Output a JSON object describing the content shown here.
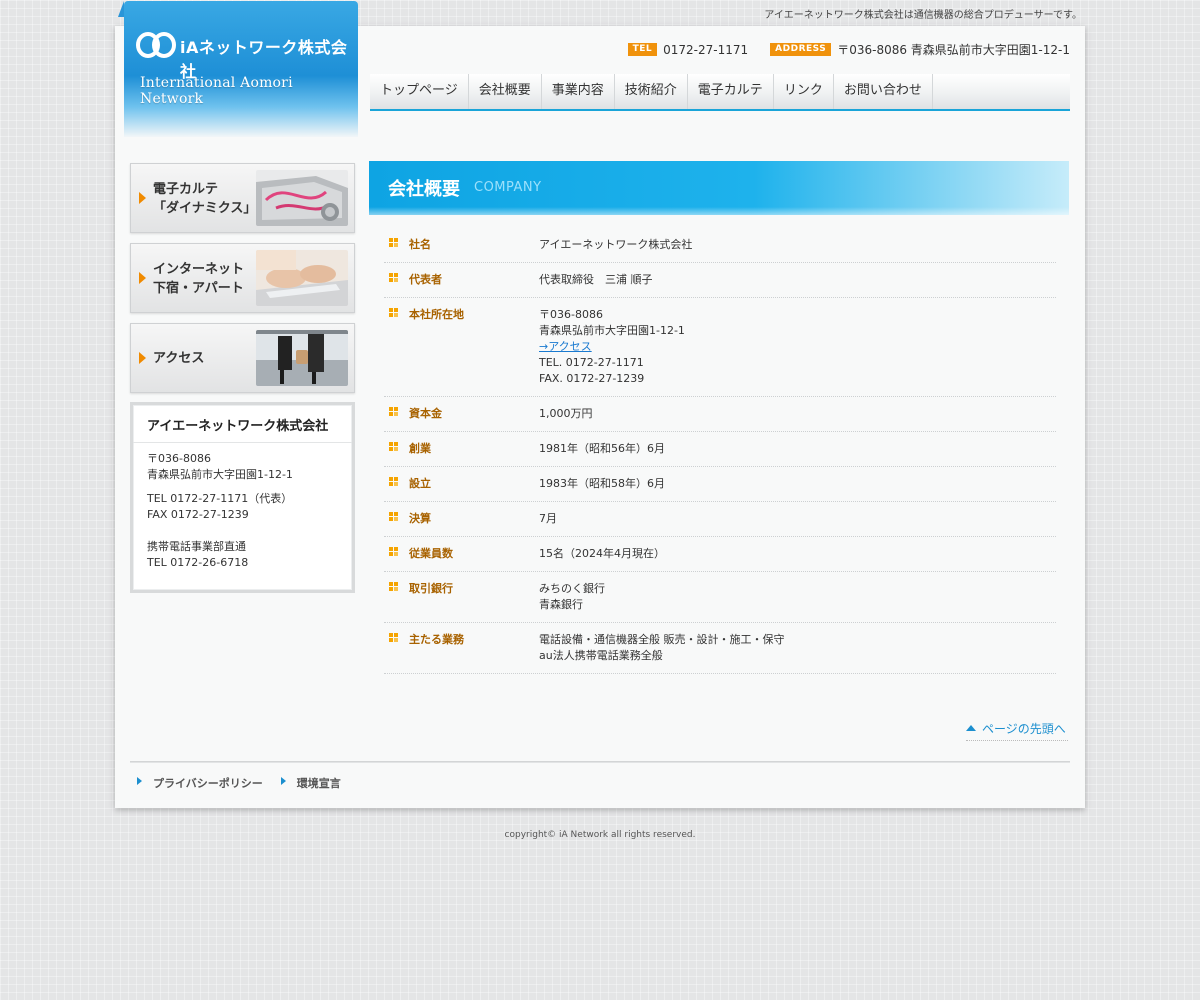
{
  "tagline": "アイエーネットワーク株式会社は通信機器の総合プロデューサーです。",
  "logo": {
    "text": "iAネットワーク株式会社",
    "sub": "International Aomori Network"
  },
  "contact": {
    "tel_badge": "TEL",
    "tel": "0172-27-1171",
    "address_badge": "ADDRESS",
    "address": "〒036-8086 青森県弘前市大字田園1-12-1"
  },
  "nav": [
    {
      "label": "トップページ"
    },
    {
      "label": "会社概要"
    },
    {
      "label": "事業内容"
    },
    {
      "label": "技術紹介"
    },
    {
      "label": "電子カルテ"
    },
    {
      "label": "リンク"
    },
    {
      "label": "お問い合わせ"
    }
  ],
  "sidebar": {
    "banners": [
      {
        "line1": "電子カルテ",
        "line2": "「ダイナミクス」"
      },
      {
        "line1": "インターネット",
        "line2": "下宿・アパート"
      },
      {
        "line1": "アクセス",
        "line2": ""
      }
    ],
    "company": {
      "name": "アイエーネットワーク株式会社",
      "zip": "〒036-8086",
      "addr": "青森県弘前市大字田園1-12-1",
      "tel": "TEL 0172-27-1171（代表）",
      "fax": "FAX 0172-27-1239",
      "mobile_label": "携帯電話事業部直通",
      "mobile_tel": "TEL 0172-26-6718"
    }
  },
  "heading": {
    "jp": "会社概要",
    "en": "COMPANY"
  },
  "rows": [
    {
      "label": "社名",
      "lines": [
        "アイエーネットワーク株式会社"
      ]
    },
    {
      "label": "代表者",
      "lines": [
        "代表取締役　三浦 順子"
      ]
    },
    {
      "label": "本社所在地",
      "lines": [
        "〒036-8086",
        "青森県弘前市大字田園1-12-1"
      ],
      "link": "→アクセス",
      "after": [
        "TEL. 0172-27-1171",
        "FAX. 0172-27-1239"
      ]
    },
    {
      "label": "資本金",
      "lines": [
        "1,000万円"
      ]
    },
    {
      "label": "創業",
      "lines": [
        "1981年（昭和56年）6月"
      ]
    },
    {
      "label": "設立",
      "lines": [
        "1983年（昭和58年）6月"
      ]
    },
    {
      "label": "決算",
      "lines": [
        "7月"
      ]
    },
    {
      "label": "従業員数",
      "lines": [
        "15名（2024年4月現在）"
      ]
    },
    {
      "label": "取引銀行",
      "lines": [
        "みちのく銀行",
        "青森銀行"
      ]
    },
    {
      "label": "主たる業務",
      "lines": [
        "電話設備・通信機器全般 販売・設計・施工・保守",
        "au法人携帯電話業務全般"
      ]
    }
  ],
  "pagetop": "ページの先頭へ",
  "footer_links": [
    {
      "label": "プライバシーポリシー"
    },
    {
      "label": "環境宣言"
    }
  ],
  "copyright": "copyright© iA Network all rights reserved.",
  "colors": {
    "accent_blue": "#1aa4d8",
    "badge_orange": "#f0920c",
    "label_brown": "#a86200"
  }
}
